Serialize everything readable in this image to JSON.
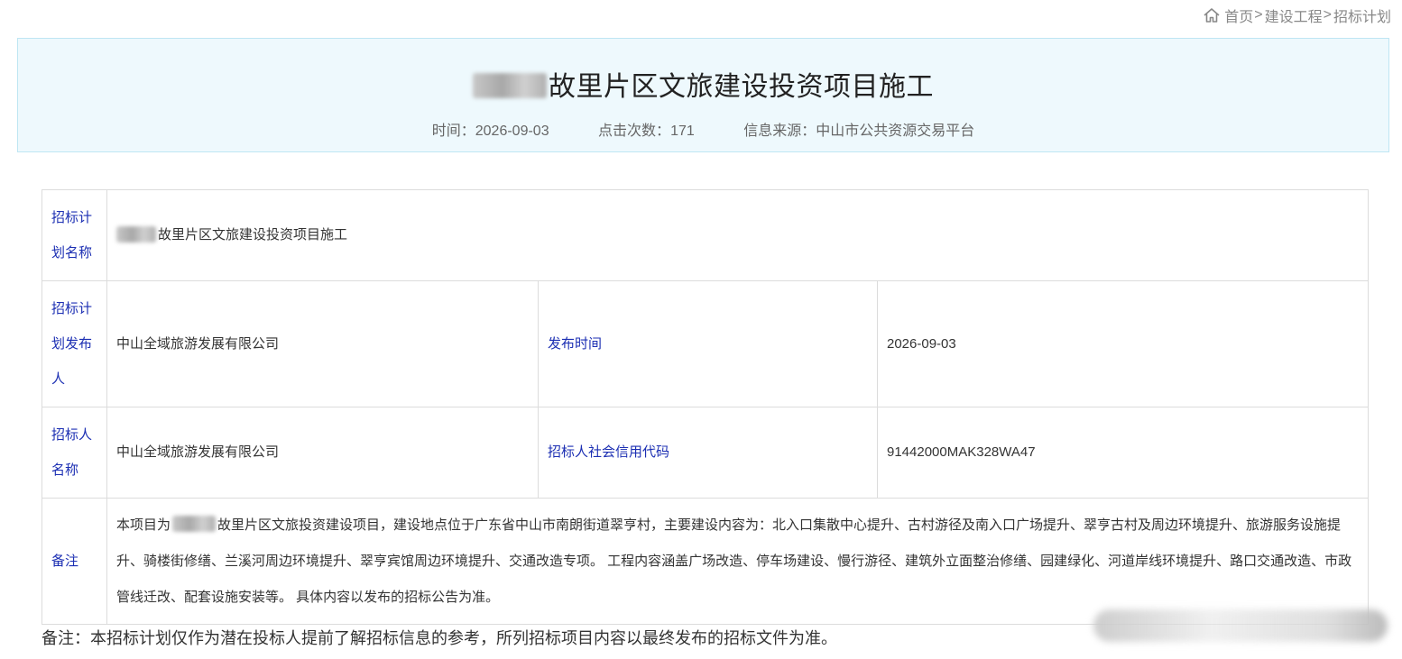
{
  "breadcrumb": {
    "home": "首页",
    "separator": ">",
    "items": [
      "建设工程",
      "招标计划"
    ]
  },
  "header": {
    "title": "故里片区文旅建设投资项目施工",
    "meta": {
      "time_label": "时间：",
      "time_value": "2026-09-03",
      "clicks_label": "点击次数：",
      "clicks_value": "171",
      "source_label": "信息来源：",
      "source_value": "中山市公共资源交易平台"
    }
  },
  "table": {
    "plan_name_label": "招标计划名称",
    "plan_name_value": "故里片区文旅建设投资项目施工",
    "publisher_label": "招标计划发布人",
    "publisher_value": "中山全域旅游发展有限公司",
    "publish_time_label": "发布时间",
    "publish_time_value": "2026-09-03",
    "tenderer_label": "招标人名称",
    "tenderer_value": "中山全域旅游发展有限公司",
    "credit_code_label": "招标人社会信用代码",
    "credit_code_value": "91442000MAK328WA47",
    "remark_label": "备注",
    "remark_prefix": "本项目为",
    "remark_value": "故里片区文旅投资建设项目，建设地点位于广东省中山市南朗街道翠亨村，主要建设内容为：北入口集散中心提升、古村游径及南入口广场提升、翠亨古村及周边环境提升、旅游服务设施提升、骑楼街修缮、兰溪河周边环境提升、翠亨宾馆周边环境提升、交通改造专项。 工程内容涵盖广场改造、停车场建设、慢行游径、建筑外立面整治修缮、园建绿化、河道岸线环境提升、路口交通改造、市政管线迁改、配套设施安装等。 具体内容以发布的招标公告为准。"
  },
  "footnote": "备注：本招标计划仅作为潜在投标人提前了解招标信息的参考，所列招标项目内容以最终发布的招标文件为准。",
  "colors": {
    "label_blue": "#1c2fb3",
    "title_bg": "#eef9fd",
    "title_border": "#bfe6f3"
  }
}
